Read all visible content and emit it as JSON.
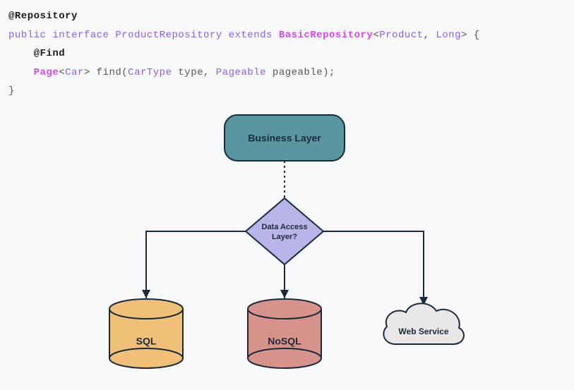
{
  "code": {
    "line1": {
      "annotation": "@Repository"
    },
    "line2": {
      "kw_public": "public",
      "kw_interface": "interface",
      "type_product_repo": "ProductRepository",
      "kw_extends": "extends",
      "type_basic_repo": "BasicRepository",
      "generic_open": "<",
      "type_product": "Product",
      "comma": ", ",
      "type_long": "Long",
      "generic_close": ">",
      "brace_open": " {"
    },
    "line3": {
      "indent": "    ",
      "annotation": "@Find"
    },
    "line4": {
      "indent": "    ",
      "type_page": "Page",
      "gen_open": "<",
      "type_car": "Car",
      "gen_close": ">",
      "method": " find(",
      "type_cartype": "CarType",
      "param1": " type, ",
      "type_pageable": "Pageable",
      "param2": " pageable);"
    },
    "line5": {
      "brace_close": "}"
    }
  },
  "diagram": {
    "business_layer": "Business Layer",
    "data_access_line1": "Data Access",
    "data_access_line2": "Layer?",
    "sql": "SQL",
    "nosql": "NoSQL",
    "webservice": "Web Service"
  }
}
